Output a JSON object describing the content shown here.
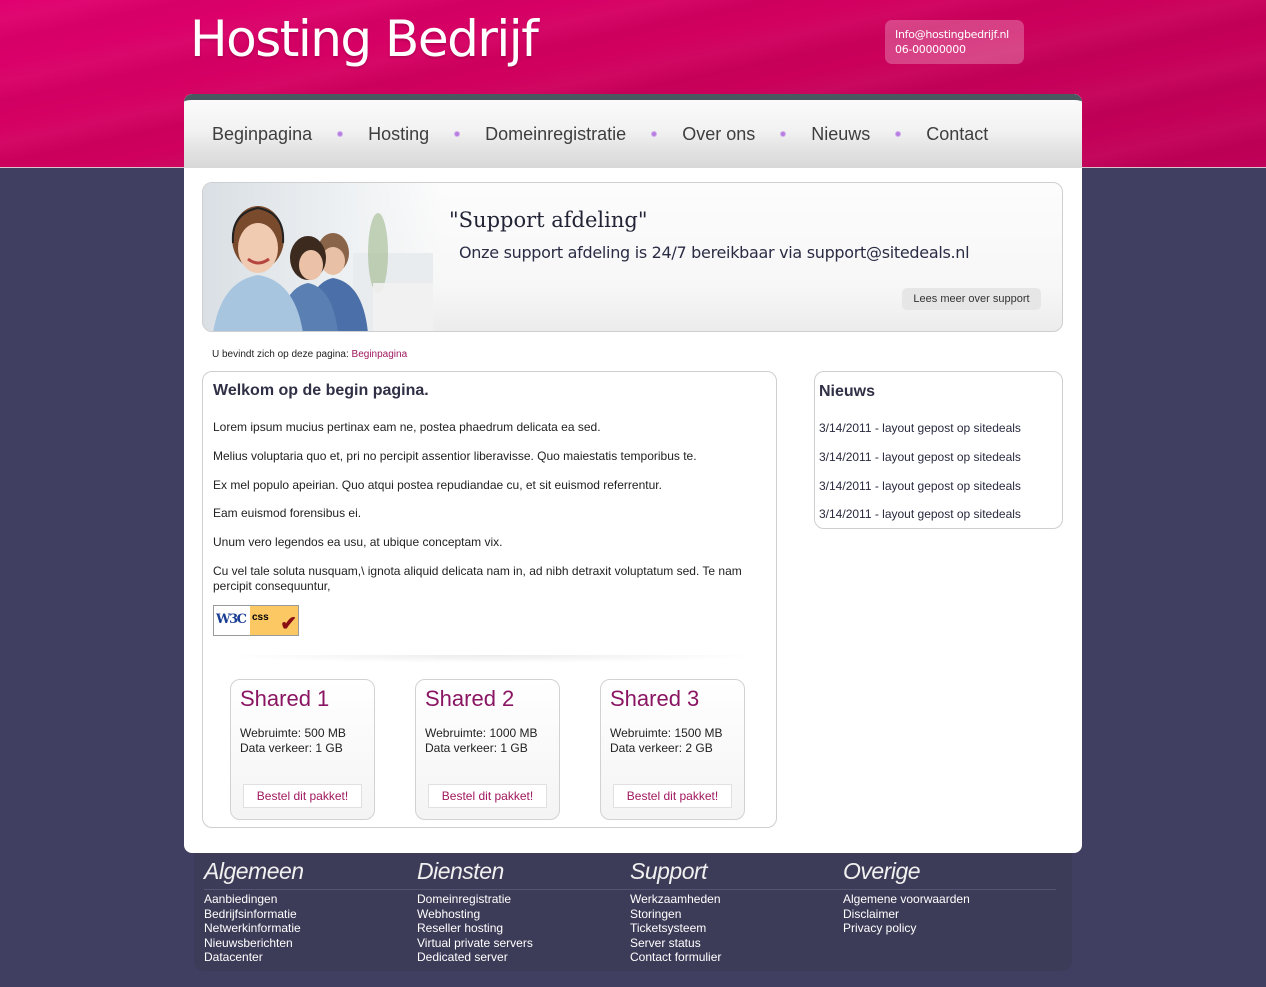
{
  "header": {
    "logo_text": "Hosting Bedrijf",
    "contact_email": "Info@hostingbedrijf.nl",
    "contact_phone": "06-00000000",
    "brand_color": "#d9006b"
  },
  "nav": {
    "items": [
      {
        "label": "Beginpagina"
      },
      {
        "label": "Hosting"
      },
      {
        "label": "Domeinregistratie"
      },
      {
        "label": "Over ons"
      },
      {
        "label": "Nieuws"
      },
      {
        "label": "Contact"
      }
    ]
  },
  "banner": {
    "title": "\"Support afdeling\"",
    "text": "Onze support afdeling is 24/7 bereikbaar via support@sitedeals.nl",
    "button_label": "Lees meer over support",
    "image_alt": "support-team-photo"
  },
  "breadcrumb": {
    "prefix": "U bevindt zich op deze pagina:",
    "current": "Beginpagina"
  },
  "main": {
    "title": "Welkom op de begin pagina.",
    "paragraphs": [
      "Lorem ipsum mucius pertinax eam ne, postea phaedrum delicata ea sed.",
      "Melius voluptaria quo et, pri no percipit assentior liberavisse. Quo maiestatis temporibus te.",
      "Ex mel populo apeirian. Quo atqui postea repudiandae cu, et sit euismod referrentur.",
      "Eam euismod forensibus ei.",
      "Unum vero legendos ea usu, at ubique conceptam vix.",
      "Cu vel tale soluta nusquam,\\ ignota aliquid delicata nam in, ad nibh detraxit voluptatum sed. Te nam percipit consequuntur,"
    ],
    "badge": {
      "left": "W3C",
      "right": "css",
      "mark": "✔"
    }
  },
  "packages": [
    {
      "title": "Shared 1",
      "space": "Webruimte: 500 MB",
      "traffic": "Data verkeer: 1 GB",
      "button": "Bestel dit pakket!"
    },
    {
      "title": "Shared 2",
      "space": "Webruimte: 1000 MB",
      "traffic": "Data verkeer: 1 GB",
      "button": "Bestel dit pakket!"
    },
    {
      "title": "Shared 3",
      "space": "Webruimte: 1500 MB",
      "traffic": "Data verkeer: 2 GB",
      "button": "Bestel dit pakket!"
    }
  ],
  "news": {
    "title": "Nieuws",
    "items": [
      "3/14/2011 - layout gepost op sitedeals",
      "3/14/2011 - layout gepost op sitedeals",
      "3/14/2011 - layout gepost op sitedeals",
      "3/14/2011 - layout gepost op sitedeals"
    ]
  },
  "footer": {
    "columns": [
      {
        "title": "Algemeen",
        "links": [
          "Aanbiedingen",
          "Bedrijfsinformatie",
          "Netwerkinformatie",
          "Nieuwsberichten",
          "Datacenter"
        ]
      },
      {
        "title": "Diensten",
        "links": [
          "Domeinregistratie",
          "Webhosting",
          "Reseller hosting",
          "Virtual private servers",
          "Dedicated server"
        ]
      },
      {
        "title": "Support",
        "links": [
          "Werkzaamheden",
          "Storingen",
          "Ticketsysteem",
          "Server status",
          "Contact formulier"
        ]
      },
      {
        "title": "Overige",
        "links": [
          "Algemene voorwaarden",
          "Disclaimer",
          "Privacy policy"
        ]
      }
    ]
  }
}
